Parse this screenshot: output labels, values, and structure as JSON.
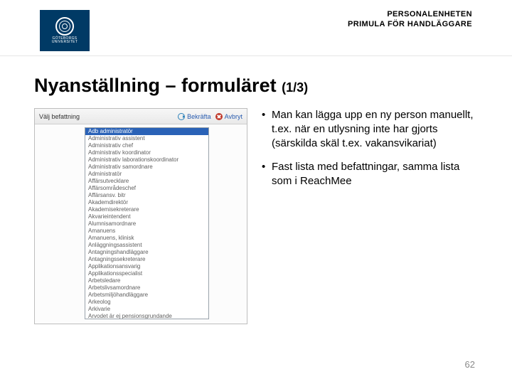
{
  "header": {
    "logo_line1": "GÖTEBORGS",
    "logo_line2": "UNIVERSITET",
    "title_line1": "PERSONALENHETEN",
    "title_line2": "PRIMULA FÖR HANDLÄGGARE"
  },
  "title": {
    "main": "Nyanställning – formuläret ",
    "counter": "(1/3)"
  },
  "app": {
    "field_label": "Välj befattning",
    "confirm_label": "Bekräfta",
    "cancel_label": "Avbryt",
    "options": [
      "Adb administratör",
      "Administrativ assistent",
      "Administrativ chef",
      "Administrativ koordinator",
      "Administrativ laborationskoordinator",
      "Administrativ samordnare",
      "Administratör",
      "Affärsutvecklare",
      "Affärsområdeschef",
      "Affärsansv. bitr",
      "Akademdirektör",
      "Akademisekreterare",
      "Akvarieintendent",
      "Alumnisamordnare",
      "Amanuens",
      "Amanuens, klinisk",
      "Anläggningsassistent",
      "Antagningshandläggare",
      "Antagningssekreterare",
      "Applikationsansvarig",
      "Applikationsspecialist",
      "Arbetsledare",
      "Arbetslivsamordnare",
      "Arbetsmiljöhandläggare",
      "Arkeolog",
      "Arkivarie",
      "Arvodet är ej pensionsgrundande"
    ],
    "selected_index": 0
  },
  "bullets": [
    "Man kan lägga upp en ny person manuellt, t.ex. när en utlysning inte har gjorts (särskilda skäl t.ex. vakansvikariat)",
    "Fast lista med befattningar, samma lista som i ReachMee"
  ],
  "page_number": "62"
}
